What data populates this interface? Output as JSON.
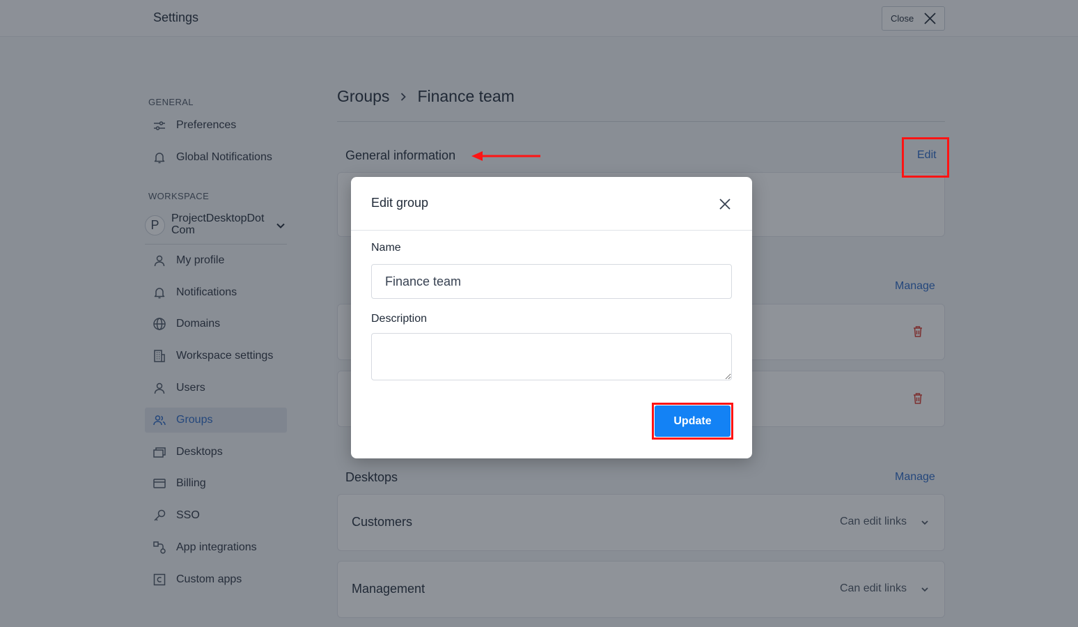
{
  "topbar": {
    "title": "Settings",
    "close_label": "Close"
  },
  "sidebar": {
    "general_label": "GENERAL",
    "general_items": [
      {
        "label": "Preferences",
        "icon": "sliders-icon"
      },
      {
        "label": "Global Notifications",
        "icon": "bell-icon"
      }
    ],
    "workspace_label": "WORKSPACE",
    "workspace": {
      "avatar_letter": "P",
      "name": "ProjectDesktopDot Com"
    },
    "workspace_items": [
      {
        "label": "My profile",
        "icon": "user-icon"
      },
      {
        "label": "Notifications",
        "icon": "bell-icon"
      },
      {
        "label": "Domains",
        "icon": "globe-icon"
      },
      {
        "label": "Workspace settings",
        "icon": "building-icon"
      },
      {
        "label": "Users",
        "icon": "user-icon"
      },
      {
        "label": "Groups",
        "icon": "users-icon",
        "active": true
      },
      {
        "label": "Desktops",
        "icon": "desktops-icon"
      },
      {
        "label": "Billing",
        "icon": "card-icon"
      },
      {
        "label": "SSO",
        "icon": "key-icon"
      },
      {
        "label": "App integrations",
        "icon": "integrations-icon"
      },
      {
        "label": "Custom apps",
        "icon": "custom-app-icon"
      }
    ]
  },
  "main": {
    "breadcrumb": {
      "parent": "Groups",
      "current": "Finance team"
    },
    "general_info": {
      "title": "General information",
      "edit_label": "Edit"
    },
    "members": {
      "manage_label": "Manage"
    },
    "desktops": {
      "title": "Desktops",
      "manage_label": "Manage",
      "rows": [
        {
          "name": "Customers",
          "permission": "Can edit links"
        },
        {
          "name": "Management",
          "permission": "Can edit links"
        }
      ]
    }
  },
  "modal": {
    "title": "Edit group",
    "name_label": "Name",
    "name_value": "Finance team",
    "description_label": "Description",
    "description_value": "",
    "update_label": "Update"
  },
  "colors": {
    "accent": "#2866c5",
    "primary_button": "#1382f5",
    "annotation": "#ff1414",
    "danger": "#d9362b"
  }
}
